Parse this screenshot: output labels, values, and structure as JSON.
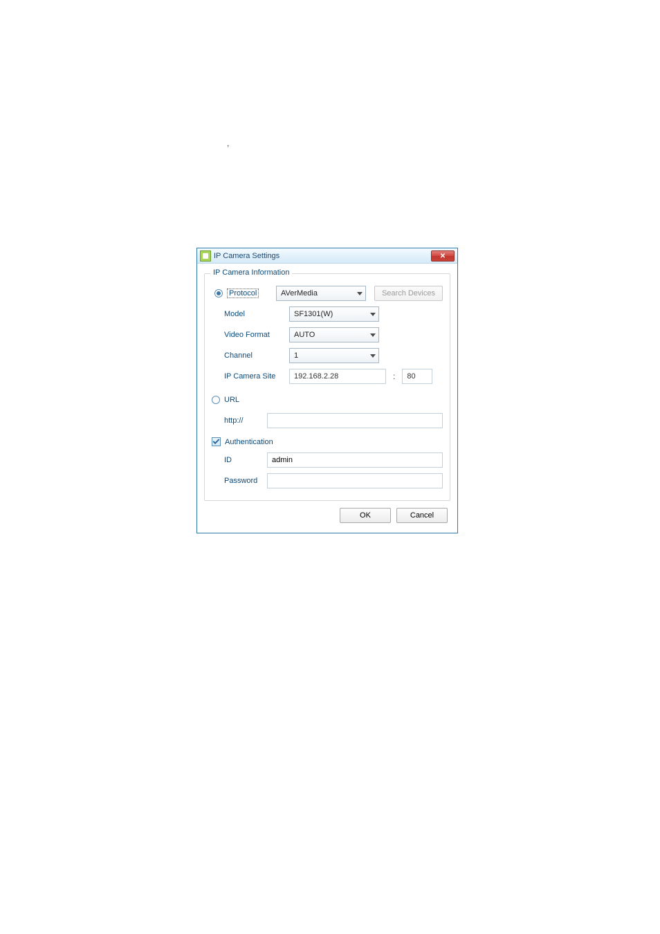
{
  "stray": ",",
  "dialog": {
    "title": "IP Camera Settings",
    "group_label": "IP Camera Information",
    "protocol": {
      "radio_label": "Protocol",
      "selected": "AVerMedia",
      "search_button": "Search Devices"
    },
    "model": {
      "label": "Model",
      "selected": "SF1301(W)"
    },
    "video_format": {
      "label": "Video Format",
      "selected": "AUTO"
    },
    "channel": {
      "label": "Channel",
      "selected": "1"
    },
    "ip_site": {
      "label": "IP Camera Site",
      "ip": "192.168.2.28",
      "port_sep": ":",
      "port": "80"
    },
    "url": {
      "radio_label": "URL",
      "prefix_label": "http://",
      "value": ""
    },
    "auth": {
      "checkbox_label": "Authentication",
      "id_label": "ID",
      "id_value": "admin",
      "password_label": "Password",
      "password_value": ""
    },
    "buttons": {
      "ok": "OK",
      "cancel": "Cancel"
    }
  }
}
